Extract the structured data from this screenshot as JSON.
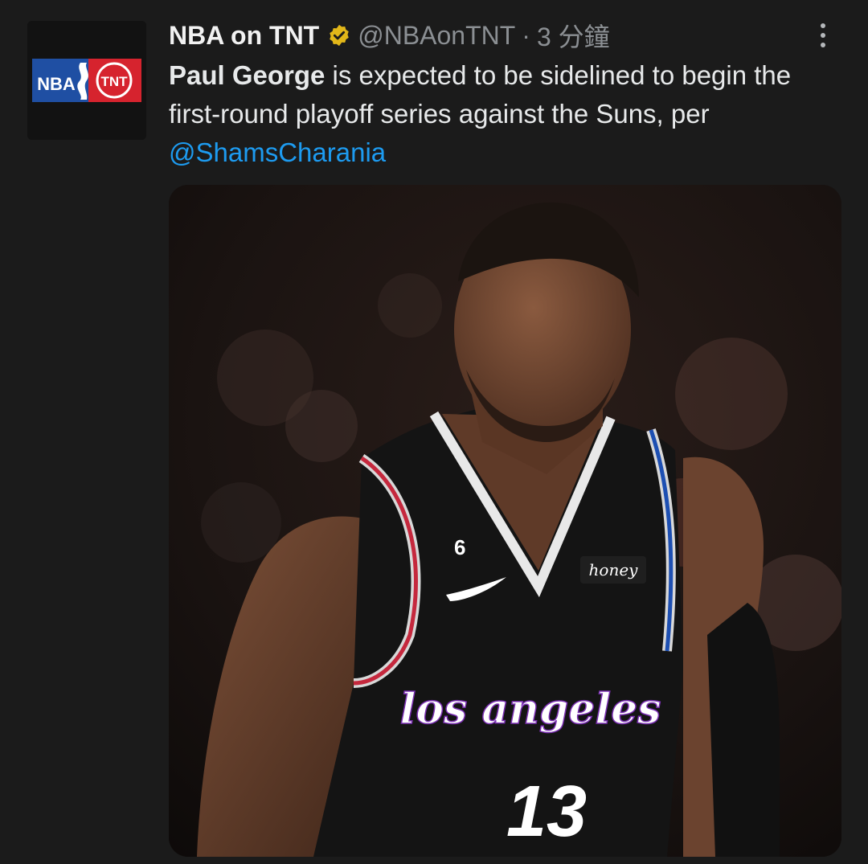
{
  "tweet": {
    "author": {
      "display_name": "NBA on TNT",
      "handle": "@NBAonTNT",
      "verified": true,
      "avatar_text_left": "NBA",
      "avatar_text_right": "TNT"
    },
    "separator": "·",
    "time": "3 分鐘",
    "text_bold": "Paul George",
    "text_rest": " is expected to be sidelined to begin the first-round playoff series against the Suns, per ",
    "mention": "@ShamsCharania",
    "media": {
      "description_icon": "photo",
      "jersey_brand": "los angeles",
      "jersey_number": "13",
      "patch_number": "6",
      "sponsor": "honey"
    }
  },
  "colors": {
    "background": "#1b1b1b",
    "accent": "#1d9bf0",
    "verified_badge": "#e2b719",
    "muted": "#8b8f93"
  }
}
